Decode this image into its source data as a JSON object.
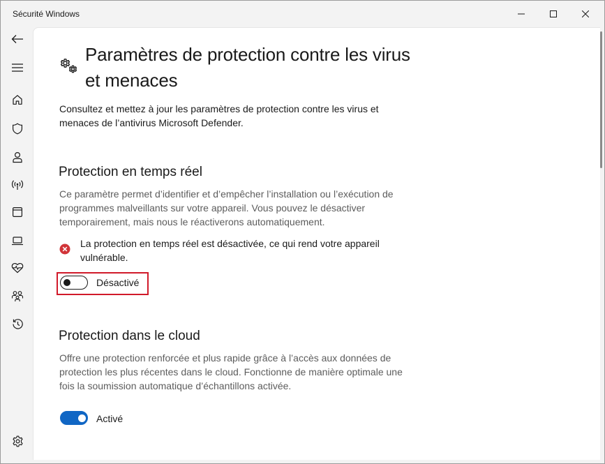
{
  "window": {
    "title": "Sécurité Windows",
    "colors": {
      "accent": "#1066c4",
      "alert": "#d13438",
      "highlight": "#d11a2a"
    }
  },
  "sidebar": {
    "items": [
      {
        "icon": "back-arrow-icon"
      },
      {
        "icon": "hamburger-menu-icon"
      },
      {
        "icon": "home-icon"
      },
      {
        "icon": "shield-icon"
      },
      {
        "icon": "account-icon"
      },
      {
        "icon": "network-icon"
      },
      {
        "icon": "app-browser-icon"
      },
      {
        "icon": "device-security-icon"
      },
      {
        "icon": "health-icon"
      },
      {
        "icon": "family-icon"
      },
      {
        "icon": "history-icon"
      },
      {
        "icon": "settings-gear-icon"
      }
    ]
  },
  "page": {
    "title": "Paramètres de protection contre les virus et menaces",
    "description": "Consultez et mettez à jour les paramètres de protection contre les virus et menaces de l’antivirus Microsoft Defender."
  },
  "realtime": {
    "title": "Protection en temps réel",
    "description": "Ce paramètre permet d’identifier et d’empêcher l’installation ou l’exécution de programmes malveillants sur votre appareil. Vous pouvez le désactiver temporairement, mais nous le réactiverons automatiquement.",
    "alert": "La protection en temps réel est désactivée, ce qui rend votre appareil vulnérable.",
    "toggle_label": "Désactivé",
    "enabled": false
  },
  "cloud": {
    "title": "Protection dans le cloud",
    "description": "Offre une protection renforcée et plus rapide grâce à l’accès aux données de protection les plus récentes dans le cloud. Fonctionne de manière optimale une fois la soumission automatique d’échantillons activée.",
    "toggle_label": "Activé",
    "enabled": true
  }
}
